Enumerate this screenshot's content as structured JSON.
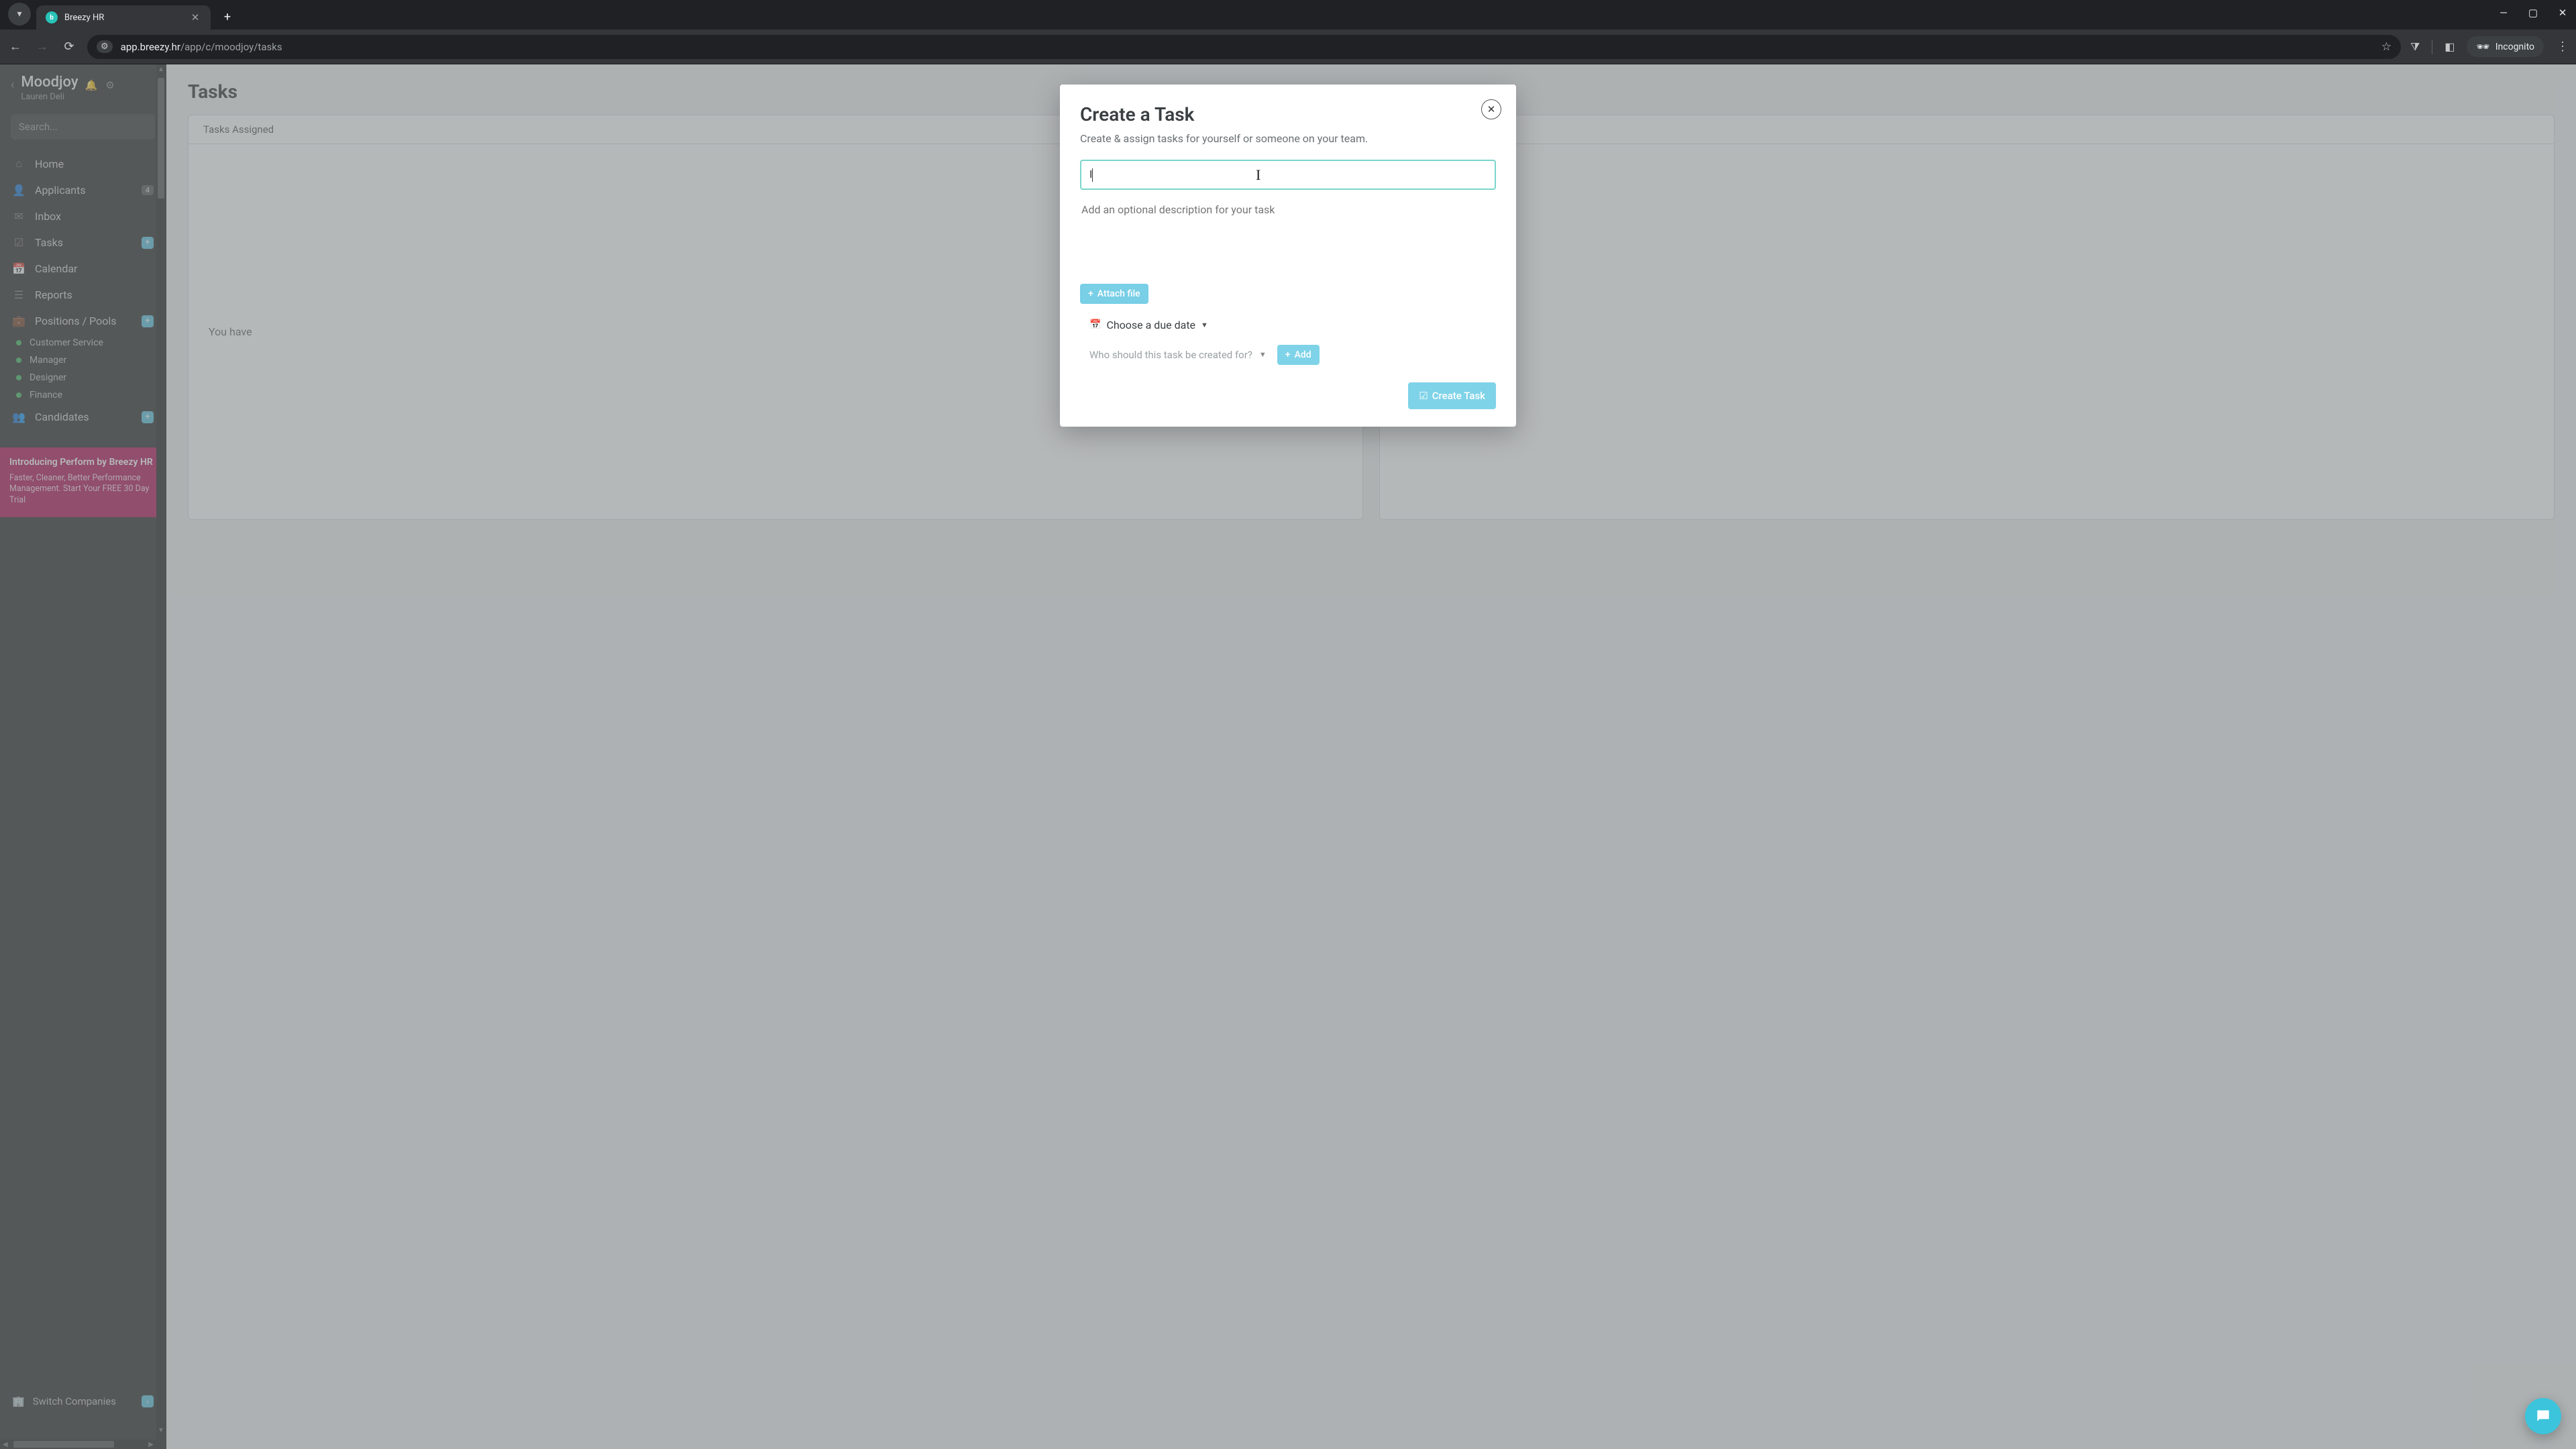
{
  "browser": {
    "tab_title": "Breezy HR",
    "url_host": "app.breezy.hr",
    "url_path": "/app/c/moodjoy/tasks",
    "incognito_label": "Incognito"
  },
  "sidebar": {
    "company": "Moodjoy",
    "user": "Lauren Deli",
    "search_placeholder": "Search...",
    "items": [
      {
        "icon": "home",
        "label": "Home"
      },
      {
        "icon": "user",
        "label": "Applicants",
        "badge": "4"
      },
      {
        "icon": "envelope",
        "label": "Inbox"
      },
      {
        "icon": "check",
        "label": "Tasks",
        "plus": true
      },
      {
        "icon": "calendar",
        "label": "Calendar"
      },
      {
        "icon": "list",
        "label": "Reports"
      },
      {
        "icon": "briefcase",
        "label": "Positions / Pools",
        "plus": true
      }
    ],
    "positions": [
      "Customer Service",
      "Manager",
      "Designer",
      "Finance"
    ],
    "candidates": {
      "label": "Candidates",
      "plus": true
    },
    "switch_label": "Switch Companies",
    "promo": {
      "title": "Introducing Perform by Breezy HR",
      "body": "Faster, Cleaner, Better Performance Management. Start Your FREE 30 Day Trial"
    }
  },
  "page": {
    "title": "Tasks",
    "tab_assigned": "Tasks Assigned",
    "empty_text": "You have"
  },
  "modal": {
    "title": "Create a Task",
    "subtitle": "Create & assign tasks for yourself or someone on your team.",
    "title_value": "I",
    "desc_placeholder": "Add an optional description for your task",
    "attach_label": "Attach file",
    "due_label": "Choose a due date",
    "who_label": "Who should this task be created for?",
    "add_label": "Add",
    "create_label": "Create Task"
  }
}
